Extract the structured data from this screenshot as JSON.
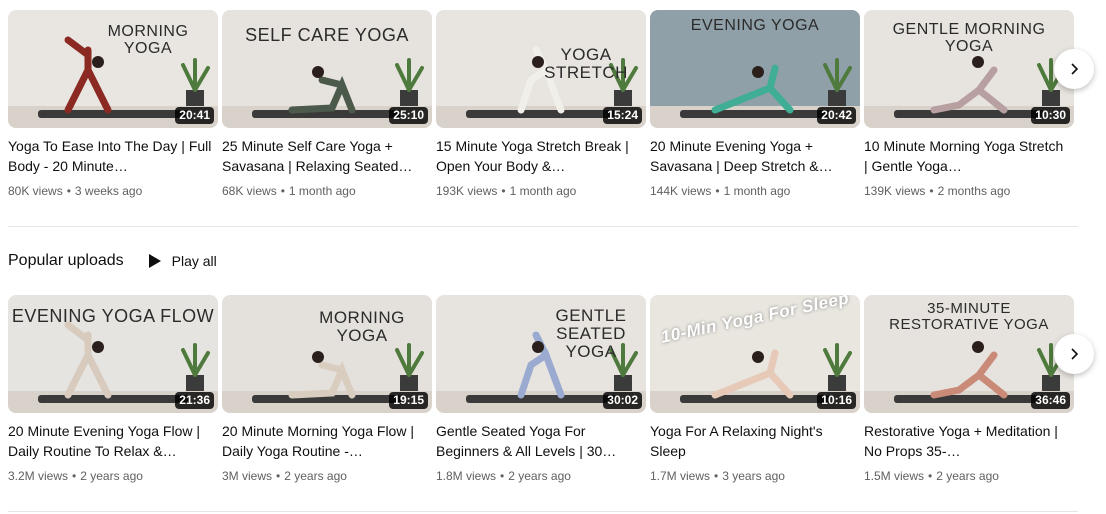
{
  "top_shelf": {
    "videos": [
      {
        "thumb_text": "MORNING\nYOGA",
        "duration": "20:41",
        "title": "Yoga To Ease Into The Day | Full Body - 20 Minute…",
        "views": "80K views",
        "age": "3 weeks ago",
        "bg": "#e9e6e1",
        "accent": "#8b2a22"
      },
      {
        "thumb_text": "SELF CARE YOGA",
        "duration": "25:10",
        "title": "25 Minute Self Care Yoga + Savasana | Relaxing Seated…",
        "views": "68K views",
        "age": "1 month ago",
        "bg": "#e6e3de",
        "accent": "#4b5a4a"
      },
      {
        "thumb_text": "YOGA\nSTRETCH",
        "duration": "15:24",
        "title": "15 Minute Yoga Stretch Break | Open Your Body &…",
        "views": "193K views",
        "age": "1 month ago",
        "bg": "#e8e5e0",
        "accent": "#f1efe9"
      },
      {
        "thumb_text": "EVENING YOGA",
        "duration": "20:42",
        "title": "20 Minute Evening Yoga + Savasana | Deep Stretch &…",
        "views": "144K views",
        "age": "1 month ago",
        "bg": "#8fa0a8",
        "accent": "#3fae94"
      },
      {
        "thumb_text": "GENTLE MORNING\nYOGA",
        "duration": "10:30",
        "title": "10 Minute Morning Yoga Stretch | Gentle Yoga…",
        "views": "139K views",
        "age": "2 months ago",
        "bg": "#e7e4df",
        "accent": "#b89fa0"
      }
    ]
  },
  "section": {
    "title": "Popular uploads",
    "play_all": "Play all"
  },
  "bottom_shelf": {
    "videos": [
      {
        "thumb_text": "EVENING YOGA FLOW",
        "duration": "21:36",
        "title": "20 Minute Evening Yoga Flow | Daily Routine To Relax &…",
        "views": "3.2M views",
        "age": "2 years ago",
        "bg": "#e6e4e0",
        "accent": "#d8cbbd"
      },
      {
        "thumb_text": "MORNING\nYOGA",
        "duration": "19:15",
        "title": "20 Minute Morning Yoga Flow | Daily Yoga Routine -…",
        "views": "3M views",
        "age": "2 years ago",
        "bg": "#e4e1dc",
        "accent": "#d9cdc0"
      },
      {
        "thumb_text": "GENTLE\nSEATED\nYOGA",
        "duration": "30:02",
        "title": "Gentle Seated Yoga For Beginners & All Levels | 30…",
        "views": "1.8M views",
        "age": "2 years ago",
        "bg": "#e7e4df",
        "accent": "#9aaad0"
      },
      {
        "thumb_text": "10-Min Yoga For Sleep",
        "duration": "10:16",
        "title": "Yoga For A Relaxing Night's Sleep",
        "views": "1.7M views",
        "age": "3 years ago",
        "bg": "#e9e5df",
        "accent": "#e7c9b8"
      },
      {
        "thumb_text": "35-MINUTE\nRESTORATIVE YOGA",
        "duration": "36:46",
        "title": "Restorative Yoga + Meditation | No Props 35-…",
        "views": "1.5M views",
        "age": "2 years ago",
        "bg": "#e6e3de",
        "accent": "#c98a78"
      }
    ]
  }
}
